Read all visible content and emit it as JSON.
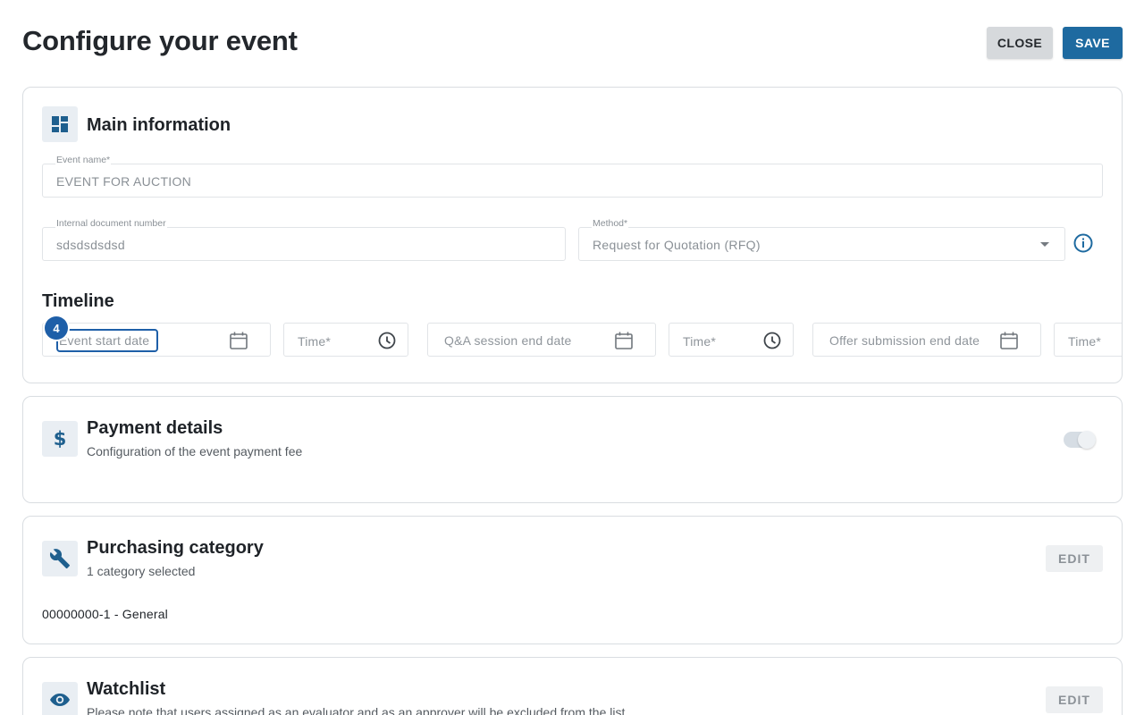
{
  "header": {
    "title": "Configure your event",
    "close_label": "CLOSE",
    "save_label": "SAVE"
  },
  "main_information": {
    "title": "Main information",
    "event_name": {
      "label": "Event name*",
      "value": "EVENT FOR AUCTION"
    },
    "internal_document_number": {
      "label": "Internal document number",
      "value": "sdsdsdsdsd"
    },
    "method": {
      "label": "Method*",
      "value": "Request for Quotation (RFQ)"
    },
    "timeline": {
      "title": "Timeline",
      "step_badge": "4",
      "event_start_date": {
        "placeholder": "Event start date"
      },
      "event_start_time": {
        "placeholder": "Time*"
      },
      "qa_session_end_date": {
        "placeholder": "Q&A session end date"
      },
      "qa_session_end_time": {
        "placeholder": "Time*"
      },
      "offer_submission_end_date": {
        "placeholder": "Offer submission end date"
      },
      "offer_submission_end_time": {
        "placeholder": "Time*"
      }
    }
  },
  "payment_details": {
    "title": "Payment details",
    "subtitle": "Configuration of the event payment fee",
    "toggle_enabled": false
  },
  "purchasing_category": {
    "title": "Purchasing category",
    "subtitle": "1 category selected",
    "edit_label": "EDIT",
    "items": [
      "00000000-1 - General"
    ]
  },
  "watchlist": {
    "title": "Watchlist",
    "subtitle": "Please note that users assigned as an evaluator and as an approver will be excluded from the list",
    "edit_label": "EDIT"
  },
  "colors": {
    "primary": "#1e6aa0",
    "accent_focus": "#1e5fa8",
    "icon_tile": "#e9eef3"
  }
}
